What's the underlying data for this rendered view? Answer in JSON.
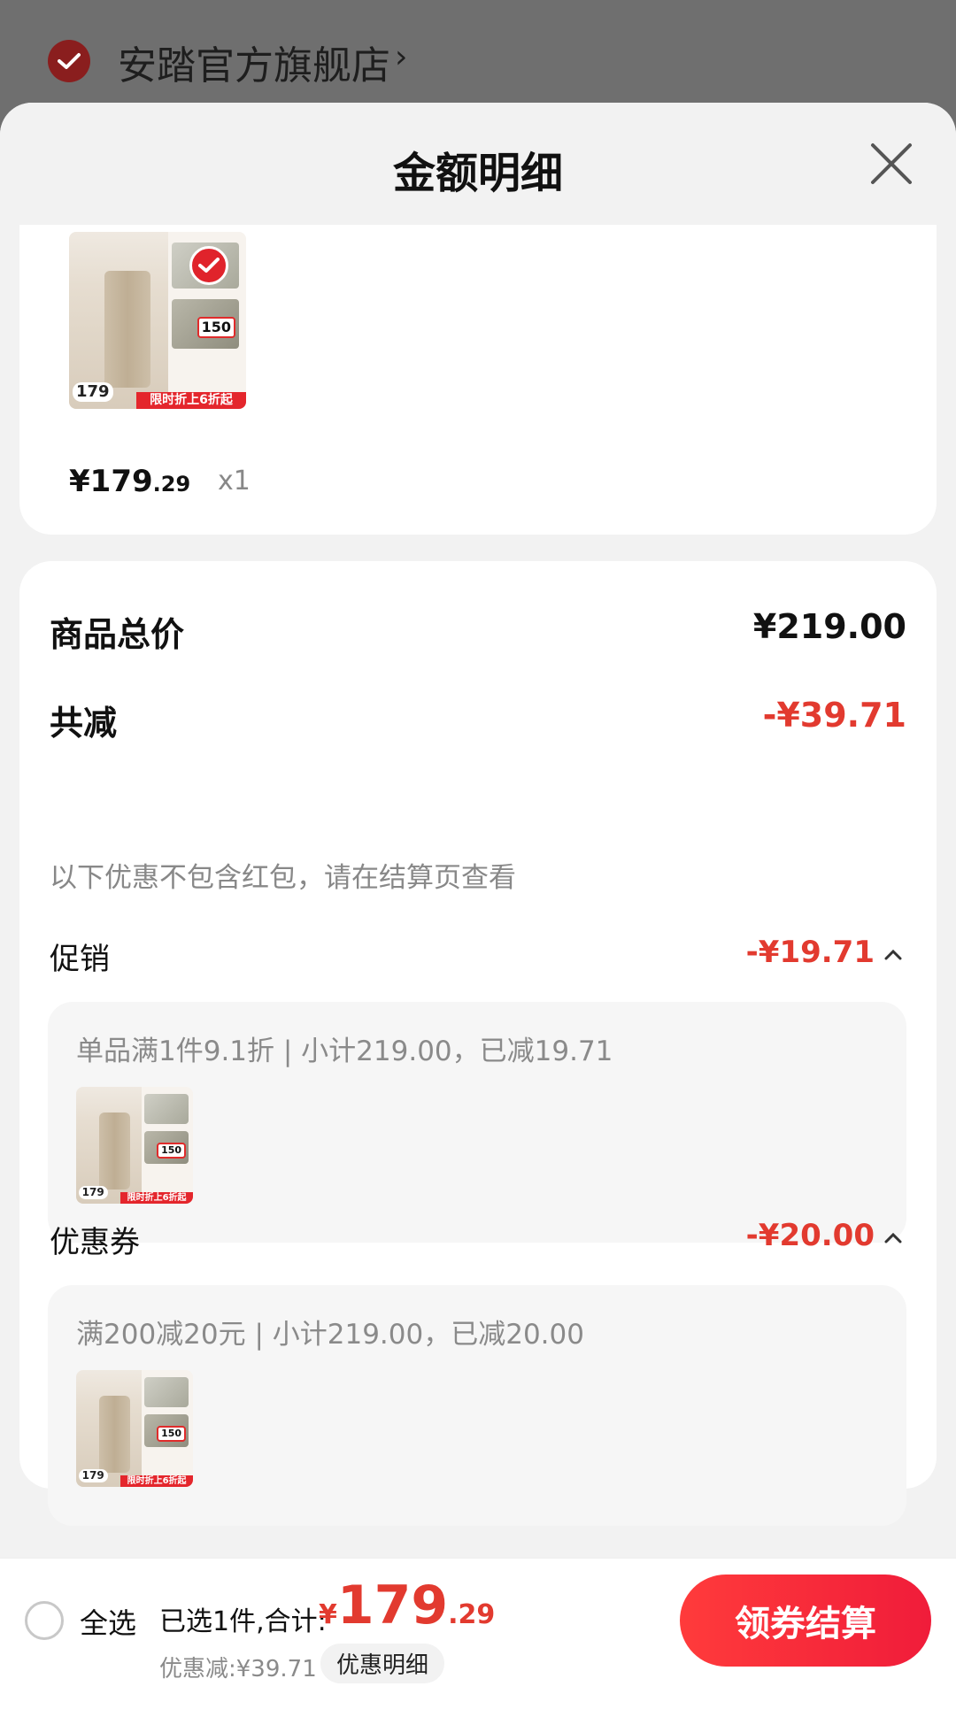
{
  "store": {
    "name": "安踏官方旗舰店",
    "arrow": "›"
  },
  "sheet": {
    "title": "金额明细"
  },
  "item": {
    "price_int": "¥179",
    "price_dec": ".29",
    "qty": "x1",
    "thumb": {
      "list_price": "179",
      "badge": "150",
      "promo": "限时折上6折起"
    }
  },
  "summary": {
    "goods_total_label": "商品总价",
    "goods_total_value": "¥219.00",
    "reduce_label": "共减",
    "reduce_value": "-¥39.71",
    "note": "以下优惠不包含红包，请在结算页查看",
    "promotion": {
      "label": "促销",
      "value": "-¥19.71",
      "detail": "单品满1件9.1折 | 小计219.00，已减19.71"
    },
    "coupon": {
      "label": "优惠券",
      "value": "-¥20.00",
      "detail": "满200减20元 | 小计219.00，已减20.00"
    }
  },
  "bottom": {
    "select_all": "全选",
    "summary_text": "已选1件,合计:",
    "currency": "¥",
    "total_int": "179",
    "total_dec": ".29",
    "discount_text": "优惠减:¥39.71",
    "detail_chip": "优惠明细",
    "checkout": "领券结算"
  },
  "colors": {
    "accent": "#e23a2f",
    "checkout_bg": "#f01c3a"
  }
}
